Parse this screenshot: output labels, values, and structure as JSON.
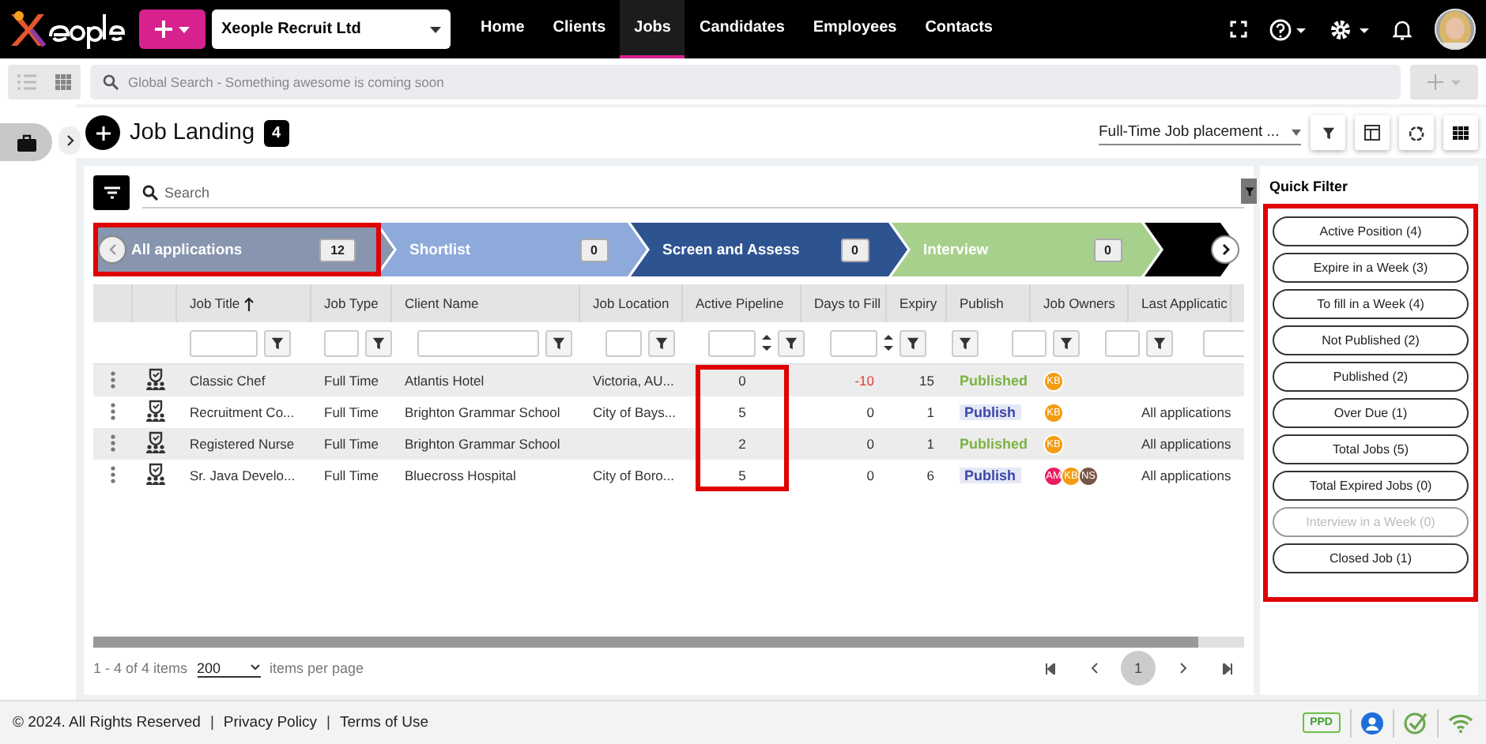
{
  "nav": {
    "company": "Xeople Recruit Ltd",
    "items": [
      {
        "label": "Home",
        "selected": false
      },
      {
        "label": "Clients",
        "selected": false
      },
      {
        "label": "Jobs",
        "selected": true
      },
      {
        "label": "Candidates",
        "selected": false
      },
      {
        "label": "Employees",
        "selected": false
      },
      {
        "label": "Contacts",
        "selected": false
      }
    ]
  },
  "toolbar": {
    "view_modes": [
      {
        "kind": "list",
        "selected": false
      },
      {
        "kind": "grid",
        "selected": true
      }
    ],
    "search_placeholder": "Global Search - Something awesome is coming soon"
  },
  "header": {
    "title": "Job Landing",
    "count": "4",
    "view": "Full-Time Job placement ..."
  },
  "search": {
    "placeholder": "Search"
  },
  "pipeline": [
    {
      "label": "All applications",
      "count": "12",
      "color": "#8795ae",
      "highlighted": true
    },
    {
      "label": "Shortlist",
      "count": "0",
      "color": "#8eaadb",
      "highlighted": false
    },
    {
      "label": "Screen and Assess",
      "count": "0",
      "color": "#2e5391",
      "highlighted": false
    },
    {
      "label": "Interview",
      "count": "0",
      "color": "#a8d08d",
      "highlighted": false
    },
    {
      "color": "#000000",
      "highlighted": false
    }
  ],
  "table": {
    "columns": [
      {
        "label": "Job Title",
        "sorted": true,
        "kind": "text"
      },
      {
        "label": "Job Type",
        "kind": "short"
      },
      {
        "label": "Client Name",
        "kind": "text"
      },
      {
        "label": "Job Location",
        "kind": "text"
      },
      {
        "label": "Active Pipeline",
        "kind": "number",
        "highlighted": true
      },
      {
        "label": "Days to Fill",
        "kind": "number"
      },
      {
        "label": "Expiry",
        "kind": "none"
      },
      {
        "label": "Publish",
        "kind": "short"
      },
      {
        "label": "Job Owners",
        "kind": "short"
      },
      {
        "label": "Last Applicatic",
        "kind": "field"
      }
    ],
    "rows": [
      {
        "title": "Classic Chef",
        "type": "Full Time",
        "client": "Atlantis Hotel",
        "location": "Victoria, AU...",
        "pipeline": "0",
        "days": "-10",
        "overdue": true,
        "expiry": "15",
        "publish": {
          "label": "Published",
          "kind": "published"
        },
        "owners": [
          {
            "initials": "KB",
            "color": "#f39c12"
          }
        ],
        "last": ""
      },
      {
        "title": "Recruitment Co...",
        "type": "Full Time",
        "client": "Brighton Grammar School",
        "location": "City of Bays...",
        "pipeline": "5",
        "days": "0",
        "overdue": false,
        "expiry": "1",
        "publish": {
          "label": "Publish",
          "kind": "action"
        },
        "owners": [
          {
            "initials": "KB",
            "color": "#f39c12"
          }
        ],
        "last": "All applications"
      },
      {
        "title": "Registered Nurse",
        "type": "Full Time",
        "client": "Brighton Grammar School",
        "location": "",
        "pipeline": "2",
        "days": "0",
        "overdue": false,
        "expiry": "1",
        "publish": {
          "label": "Published",
          "kind": "published"
        },
        "owners": [
          {
            "initials": "KB",
            "color": "#f39c12"
          }
        ],
        "last": "All applications"
      },
      {
        "title": "Sr. Java Develo...",
        "type": "Full Time",
        "client": "Bluecross Hospital",
        "location": "City of Boro...",
        "pipeline": "5",
        "days": "0",
        "overdue": false,
        "expiry": "6",
        "publish": {
          "label": "Publish",
          "kind": "action"
        },
        "owners": [
          {
            "initials": "AM",
            "color": "#e91e63"
          },
          {
            "initials": "KB",
            "color": "#f39c12"
          },
          {
            "initials": "NS",
            "color": "#795548"
          }
        ],
        "last": "All applications"
      }
    ]
  },
  "pager": {
    "summary": "1 - 4 of 4 items",
    "page_size": "200",
    "per_page": "items per page",
    "pages": [
      {
        "label": "1",
        "selected": true
      }
    ]
  },
  "quick_filter": {
    "title": "Quick Filter",
    "highlighted": true,
    "items": [
      {
        "label": "Active Position (4)",
        "disabled": false
      },
      {
        "label": "Expire in a Week (3)",
        "disabled": false
      },
      {
        "label": "To fill in a Week (4)",
        "disabled": false
      },
      {
        "label": "Not Published (2)",
        "disabled": false
      },
      {
        "label": "Published (2)",
        "disabled": false
      },
      {
        "label": "Over Due (1)",
        "disabled": false
      },
      {
        "label": "Total Jobs (5)",
        "disabled": false
      },
      {
        "label": "Total Expired Jobs (0)",
        "disabled": false
      },
      {
        "label": "Interview in a Week (0)",
        "disabled": true
      },
      {
        "label": "Closed Job (1)",
        "disabled": false
      }
    ]
  },
  "footer": {
    "copyright": "© 2024. All Rights Reserved",
    "links": [
      {
        "separator": "|",
        "label": "Privacy Policy"
      },
      {
        "separator": "|",
        "label": "Terms of Use"
      }
    ],
    "badge": "PPD"
  }
}
